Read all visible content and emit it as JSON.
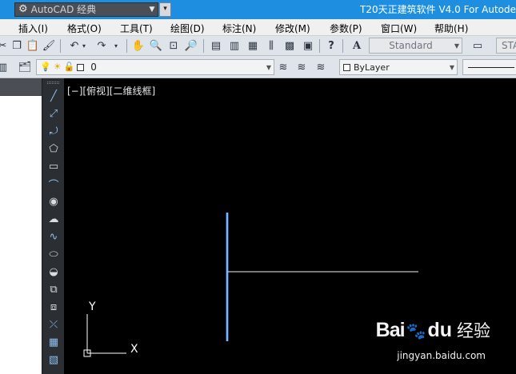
{
  "titlebar": {
    "workspace": "AutoCAD 经典",
    "app_title": "T20天正建筑软件 V4.0 For Autode"
  },
  "menu": [
    "插入(I)",
    "格式(O)",
    "工具(T)",
    "绘图(D)",
    "标注(N)",
    "修改(M)",
    "参数(P)",
    "窗口(W)",
    "帮助(H)"
  ],
  "toolbar": {
    "text_style": "Standard",
    "table_style": "STA"
  },
  "layers": {
    "current_layer": "0",
    "color": "ByLayer"
  },
  "viewport": {
    "label": "[−][俯视][二维线框]"
  },
  "ucs": {
    "y_label": "Y",
    "x_label": "X"
  },
  "watermark": {
    "brand_left": "Bai",
    "brand_right": "du",
    "brand_cn": "经验",
    "url": "jingyan.baidu.com"
  },
  "colors": {
    "title_bar": "#1e8fe0",
    "canvas": "#000000",
    "selected_line": "#6aa8ff",
    "drawn_line": "#ffffff"
  }
}
